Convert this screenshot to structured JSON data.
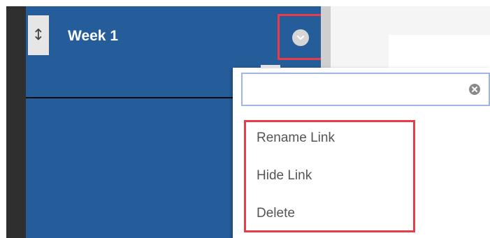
{
  "item": {
    "title": "Week 1",
    "handle_icon": "vertical-resize-icon",
    "options_icon": "chevron-down-circle-icon"
  },
  "dropdown": {
    "search": {
      "value": "",
      "placeholder": "",
      "clear_icon": "clear-circle-icon"
    },
    "menu_items": [
      {
        "label": "Rename Link"
      },
      {
        "label": "Hide Link"
      },
      {
        "label": "Delete"
      }
    ]
  },
  "colors": {
    "panel_blue": "#245d99",
    "highlight_red": "#ea3b48",
    "menu_text": "#555555"
  }
}
